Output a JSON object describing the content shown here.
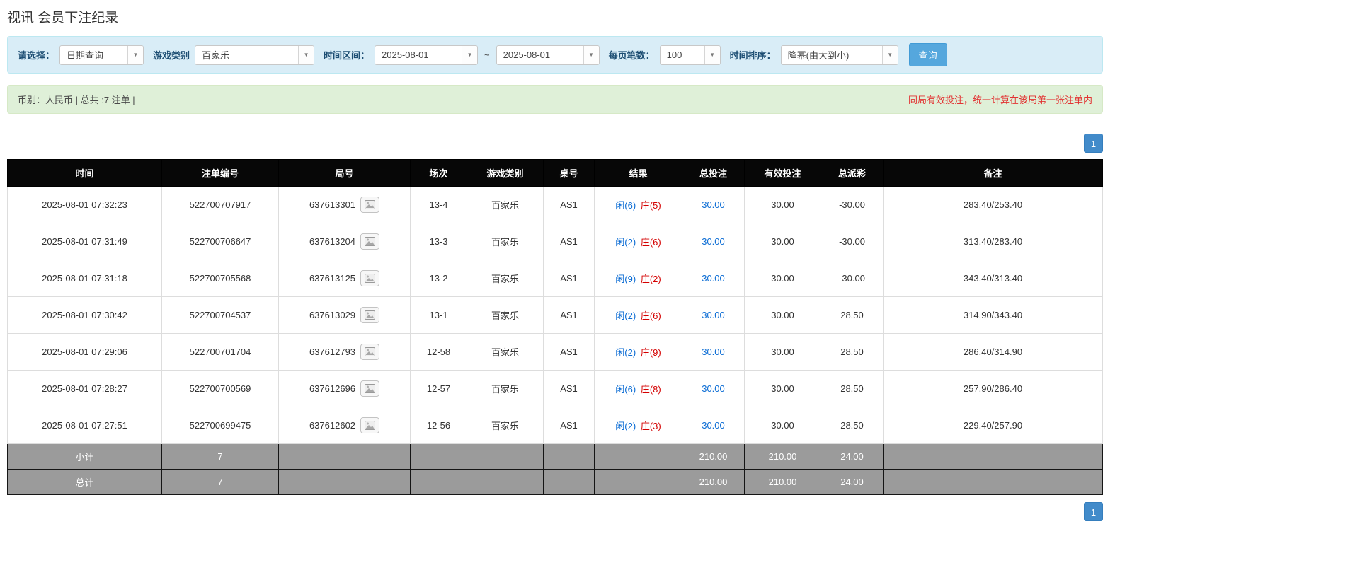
{
  "page": {
    "title": "视讯 会员下注纪录"
  },
  "icons": {
    "chevron_down": "▼"
  },
  "colors": {
    "accent_blue": "#428bca",
    "search_button_blue": "#55a7dd",
    "filter_bar_bg": "#d9edf7",
    "summary_bar_bg": "#dff0d8",
    "player_blue": "#0b6cd4",
    "banker_red": "#d40000",
    "negative_red": "#e60000",
    "header_black": "#070707",
    "footer_gray": "#9b9b9b"
  },
  "filters": {
    "select_label": "请选择：",
    "select_value": "日期查询",
    "game_type_label": "游戏类别",
    "game_type_value": "百家乐",
    "time_range_label": "时间区间：",
    "time_from": "2025-08-01",
    "time_separator": "~",
    "time_to": "2025-08-01",
    "page_size_label": "每页笔数：",
    "page_size_value": "100",
    "sort_label": "时间排序：",
    "sort_value": "降幂(由大到小)",
    "search_button": "查询"
  },
  "summary": {
    "left": "币别：人民币 | 总共 :7 注单 |",
    "right": "同局有效投注，统一计算在该局第一张注单内"
  },
  "pagination": {
    "page": "1"
  },
  "table": {
    "headers": [
      "时间",
      "注单编号",
      "局号",
      "场次",
      "游戏类别",
      "桌号",
      "结果",
      "总投注",
      "有效投注",
      "总派彩",
      "备注"
    ],
    "rows": [
      {
        "time": "2025-08-01 07:32:23",
        "order_id": "522700707917",
        "round_id": "637613301",
        "session": "13-4",
        "game": "百家乐",
        "table_no": "AS1",
        "result_player": "闲(6)",
        "result_banker": "庄(5)",
        "total_bet": "30.00",
        "valid_bet": "30.00",
        "payout": "-30.00",
        "note": "283.40/253.40"
      },
      {
        "time": "2025-08-01 07:31:49",
        "order_id": "522700706647",
        "round_id": "637613204",
        "session": "13-3",
        "game": "百家乐",
        "table_no": "AS1",
        "result_player": "闲(2)",
        "result_banker": "庄(6)",
        "total_bet": "30.00",
        "valid_bet": "30.00",
        "payout": "-30.00",
        "note": "313.40/283.40"
      },
      {
        "time": "2025-08-01 07:31:18",
        "order_id": "522700705568",
        "round_id": "637613125",
        "session": "13-2",
        "game": "百家乐",
        "table_no": "AS1",
        "result_player": "闲(9)",
        "result_banker": "庄(2)",
        "total_bet": "30.00",
        "valid_bet": "30.00",
        "payout": "-30.00",
        "note": "343.40/313.40"
      },
      {
        "time": "2025-08-01 07:30:42",
        "order_id": "522700704537",
        "round_id": "637613029",
        "session": "13-1",
        "game": "百家乐",
        "table_no": "AS1",
        "result_player": "闲(2)",
        "result_banker": "庄(6)",
        "total_bet": "30.00",
        "valid_bet": "30.00",
        "payout": "28.50",
        "note": "314.90/343.40"
      },
      {
        "time": "2025-08-01 07:29:06",
        "order_id": "522700701704",
        "round_id": "637612793",
        "session": "12-58",
        "game": "百家乐",
        "table_no": "AS1",
        "result_player": "闲(2)",
        "result_banker": "庄(9)",
        "total_bet": "30.00",
        "valid_bet": "30.00",
        "payout": "28.50",
        "note": "286.40/314.90"
      },
      {
        "time": "2025-08-01 07:28:27",
        "order_id": "522700700569",
        "round_id": "637612696",
        "session": "12-57",
        "game": "百家乐",
        "table_no": "AS1",
        "result_player": "闲(6)",
        "result_banker": "庄(8)",
        "total_bet": "30.00",
        "valid_bet": "30.00",
        "payout": "28.50",
        "note": "257.90/286.40"
      },
      {
        "time": "2025-08-01 07:27:51",
        "order_id": "522700699475",
        "round_id": "637612602",
        "session": "12-56",
        "game": "百家乐",
        "table_no": "AS1",
        "result_player": "闲(2)",
        "result_banker": "庄(3)",
        "total_bet": "30.00",
        "valid_bet": "30.00",
        "payout": "28.50",
        "note": "229.40/257.90"
      }
    ],
    "subtotal": {
      "label": "小计",
      "count": "7",
      "total_bet": "210.00",
      "valid_bet": "210.00",
      "payout": "24.00"
    },
    "total": {
      "label": "总计",
      "count": "7",
      "total_bet": "210.00",
      "valid_bet": "210.00",
      "payout": "24.00"
    }
  }
}
